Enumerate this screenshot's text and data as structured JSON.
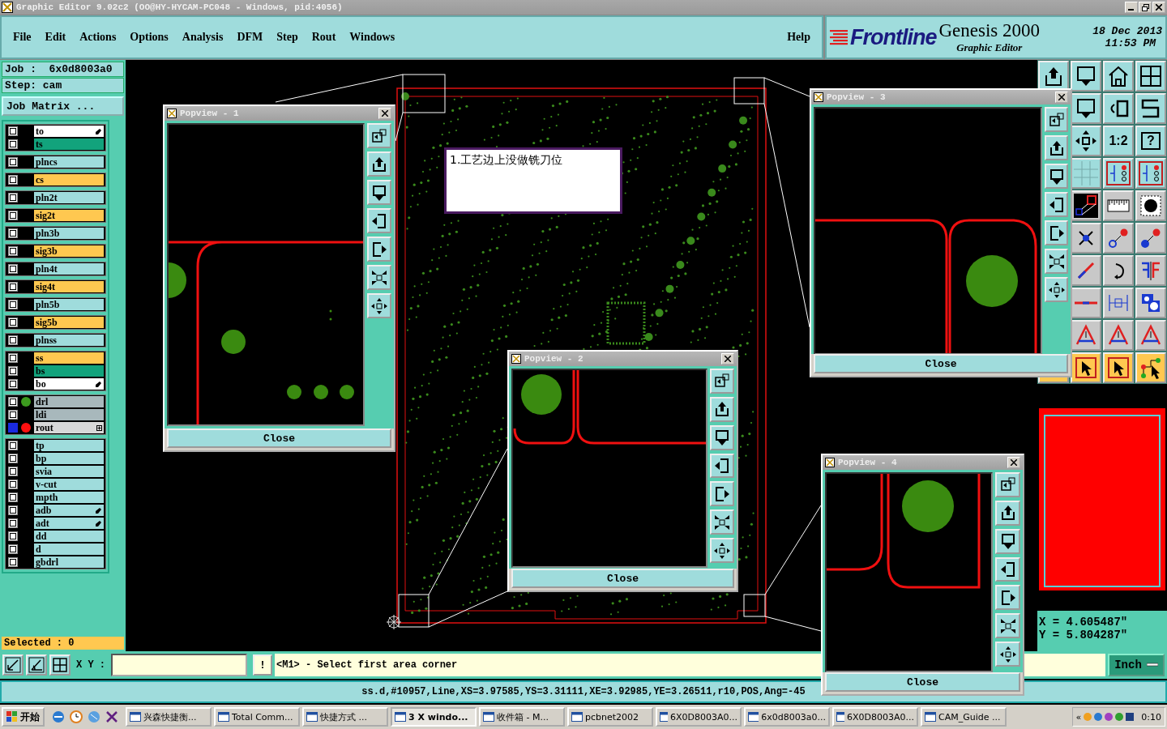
{
  "window": {
    "title": "Graphic Editor 9.02c2 (OO@HY-HYCAM-PC048 - Windows, pid:4056)"
  },
  "menu": [
    {
      "label": "File"
    },
    {
      "label": "Edit"
    },
    {
      "label": "Actions"
    },
    {
      "label": "Options"
    },
    {
      "label": "Analysis"
    },
    {
      "label": "DFM"
    },
    {
      "label": "Step"
    },
    {
      "label": "Rout"
    },
    {
      "label": "Windows"
    }
  ],
  "help_menu": "Help",
  "logo": {
    "brand": "Frontline",
    "product": "Genesis 2000",
    "subtitle": "Graphic Editor",
    "date": "18 Dec 2013",
    "time": "11:53 PM"
  },
  "job": {
    "job": "Job :  6x0d8003a0",
    "step": "Step: cam",
    "matrix_button": "Job Matrix ..."
  },
  "layer_groups": [
    [
      {
        "name": "to",
        "color": "#ffffff",
        "edit_icon": true,
        "active": false
      },
      {
        "name": "ts",
        "color": "#12a37c",
        "edit_icon": false,
        "active": false
      }
    ],
    [
      {
        "name": "plncs",
        "color": "#9fdcdc",
        "edit_icon": false,
        "active": false
      }
    ],
    [
      {
        "name": "cs",
        "color": "#ffc850",
        "edit_icon": false,
        "active": false
      }
    ],
    [
      {
        "name": "pln2t",
        "color": "#9fdcdc",
        "edit_icon": false,
        "active": false
      }
    ],
    [
      {
        "name": "sig2t",
        "color": "#ffc850",
        "edit_icon": false,
        "active": false
      }
    ],
    [
      {
        "name": "pln3b",
        "color": "#9fdcdc",
        "edit_icon": false,
        "active": false
      }
    ],
    [
      {
        "name": "sig3b",
        "color": "#ffc850",
        "edit_icon": false,
        "active": false
      }
    ],
    [
      {
        "name": "pln4t",
        "color": "#9fdcdc",
        "edit_icon": false,
        "active": false
      }
    ],
    [
      {
        "name": "sig4t",
        "color": "#ffc850",
        "edit_icon": false,
        "active": false
      }
    ],
    [
      {
        "name": "pln5b",
        "color": "#9fdcdc",
        "edit_icon": false,
        "active": false
      }
    ],
    [
      {
        "name": "sig5b",
        "color": "#ffc850",
        "edit_icon": false,
        "active": false
      }
    ],
    [
      {
        "name": "plnss",
        "color": "#9fdcdc",
        "edit_icon": false,
        "active": false
      }
    ],
    [
      {
        "name": "ss",
        "color": "#ffc850",
        "edit_icon": false,
        "active": false
      },
      {
        "name": "bs",
        "color": "#12a37c",
        "edit_icon": false,
        "active": false
      },
      {
        "name": "bo",
        "color": "#ffffff",
        "edit_icon": true,
        "active": false
      }
    ],
    [
      {
        "name": "drl",
        "color": "#a8b8bc",
        "marker": {
          "color": "#3c9a1e"
        },
        "edit_icon": false,
        "active": false
      },
      {
        "name": "ldi",
        "color": "#a8b8bc",
        "edit_icon": false,
        "active": false
      },
      {
        "name": "rout",
        "color": "#d8d8d8",
        "marker": {
          "color": "#ff1010"
        },
        "edit_icon": false,
        "expand_icon": true,
        "active": true
      }
    ],
    [
      {
        "name": "tp",
        "color": "#9fdcdc",
        "edit_icon": false,
        "active": false
      },
      {
        "name": "bp",
        "color": "#9fdcdc",
        "edit_icon": false,
        "active": false
      },
      {
        "name": "svia",
        "color": "#9fdcdc",
        "edit_icon": false,
        "active": false
      },
      {
        "name": "v-cut",
        "color": "#9fdcdc",
        "edit_icon": false,
        "active": false
      },
      {
        "name": "mpth",
        "color": "#9fdcdc",
        "edit_icon": false,
        "active": false
      },
      {
        "name": "adb",
        "color": "#9fdcdc",
        "edit_icon": true,
        "active": false
      },
      {
        "name": "adt",
        "color": "#9fdcdc",
        "edit_icon": true,
        "active": false
      },
      {
        "name": "dd",
        "color": "#9fdcdc",
        "edit_icon": false,
        "active": false
      },
      {
        "name": "d",
        "color": "#9fdcdc",
        "edit_icon": false,
        "active": false
      },
      {
        "name": "gbdrl",
        "color": "#9fdcdc",
        "edit_icon": false,
        "active": false
      }
    ]
  ],
  "selected_count": "Selected : 0",
  "note": "1.工艺边上没做铣刀位",
  "popviews": [
    {
      "title": "Popview - 1",
      "close": "Close"
    },
    {
      "title": "Popview - 2",
      "close": "Close"
    },
    {
      "title": "Popview - 3",
      "close": "Close"
    },
    {
      "title": "Popview - 4",
      "close": "Close"
    }
  ],
  "tool_labels": {
    "ratio": "1:2",
    "help": "?"
  },
  "coords": {
    "x": "X = 4.605487\"",
    "y": "Y = 5.804287\""
  },
  "command_bar": {
    "xy_label": "X Y :",
    "alert": "!",
    "message": "<M1> - Select first area corner",
    "units": "Inch"
  },
  "status": "ss.d,#10957,Line,XS=3.97585,YS=3.31111,XE=3.92985,YE=3.26511,r10,POS,Ang=-45",
  "taskbar": {
    "start": "开始",
    "tasks": [
      {
        "label": "兴森快捷衡...",
        "selected": false
      },
      {
        "label": "Total Comm...",
        "selected": false
      },
      {
        "label": "快捷方式 ...",
        "selected": false
      },
      {
        "label": "3 X windo...",
        "selected": true
      },
      {
        "label": "收件箱 - M...",
        "selected": false
      },
      {
        "label": "pcbnet2002",
        "selected": false
      },
      {
        "label": "6X0D8003A0...",
        "selected": false
      },
      {
        "label": "6x0d8003a0...",
        "selected": false
      },
      {
        "label": "6X0D8003A0...",
        "selected": false
      },
      {
        "label": "CAM_Guide ...",
        "selected": false
      }
    ],
    "tray_collapse": "«",
    "clock": "0:10"
  }
}
